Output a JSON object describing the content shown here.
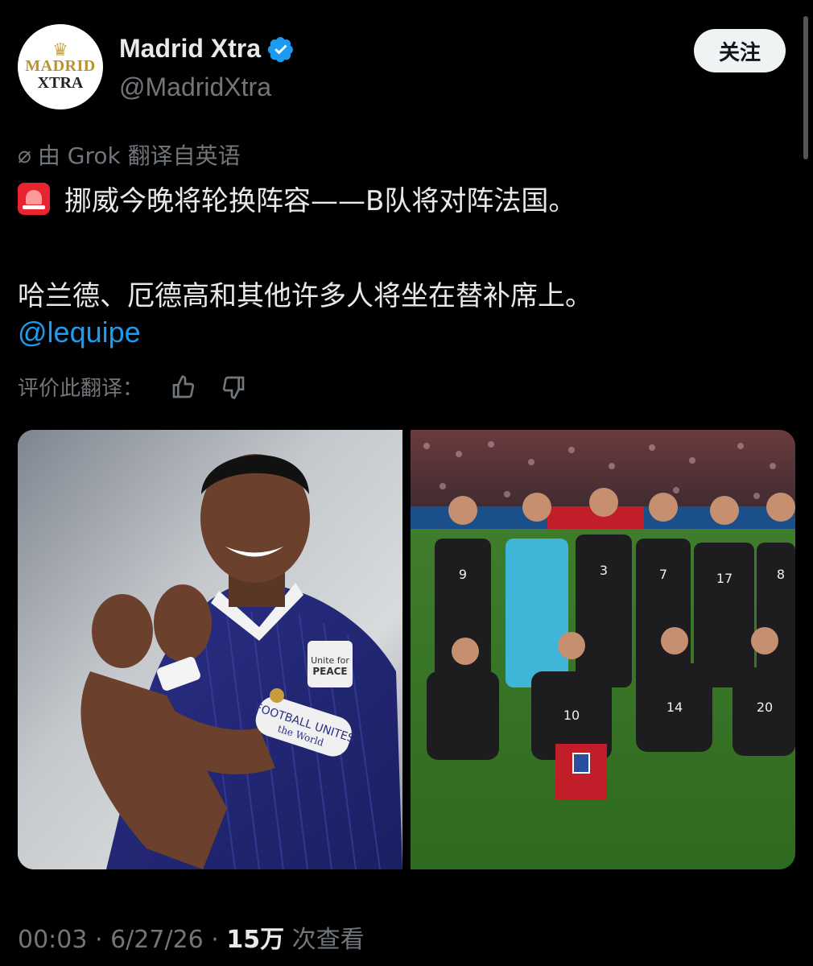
{
  "account": {
    "avatar_line1": "MADRID",
    "avatar_line2": "XTRA",
    "display_name": "Madrid Xtra",
    "handle": "@MadridXtra",
    "follow_label": "关注"
  },
  "post": {
    "translated_label": "由 Grok 翻译自英语",
    "line1": "挪威今晚将轮换阵容——B队将对阵法国。",
    "line2": "哈兰德、厄德高和其他许多人将坐在替补席上。",
    "mention": "@lequipe",
    "rate_label": "评价此翻译："
  },
  "media": {
    "left_armband": "FOOTBALL UNITES the World",
    "left_patch": "Unite for PEACE",
    "right_shirt_numbers": [
      "9",
      "3",
      "7",
      "17",
      "8",
      "10",
      "14",
      "20"
    ]
  },
  "footer": {
    "time": "00:03",
    "date": "6/27/26",
    "views_count": "15万",
    "views_label": "次查看"
  },
  "colors": {
    "background": "#000000",
    "link": "#1d9bf0",
    "muted": "#71767b",
    "verified": "#1d9bf0"
  }
}
